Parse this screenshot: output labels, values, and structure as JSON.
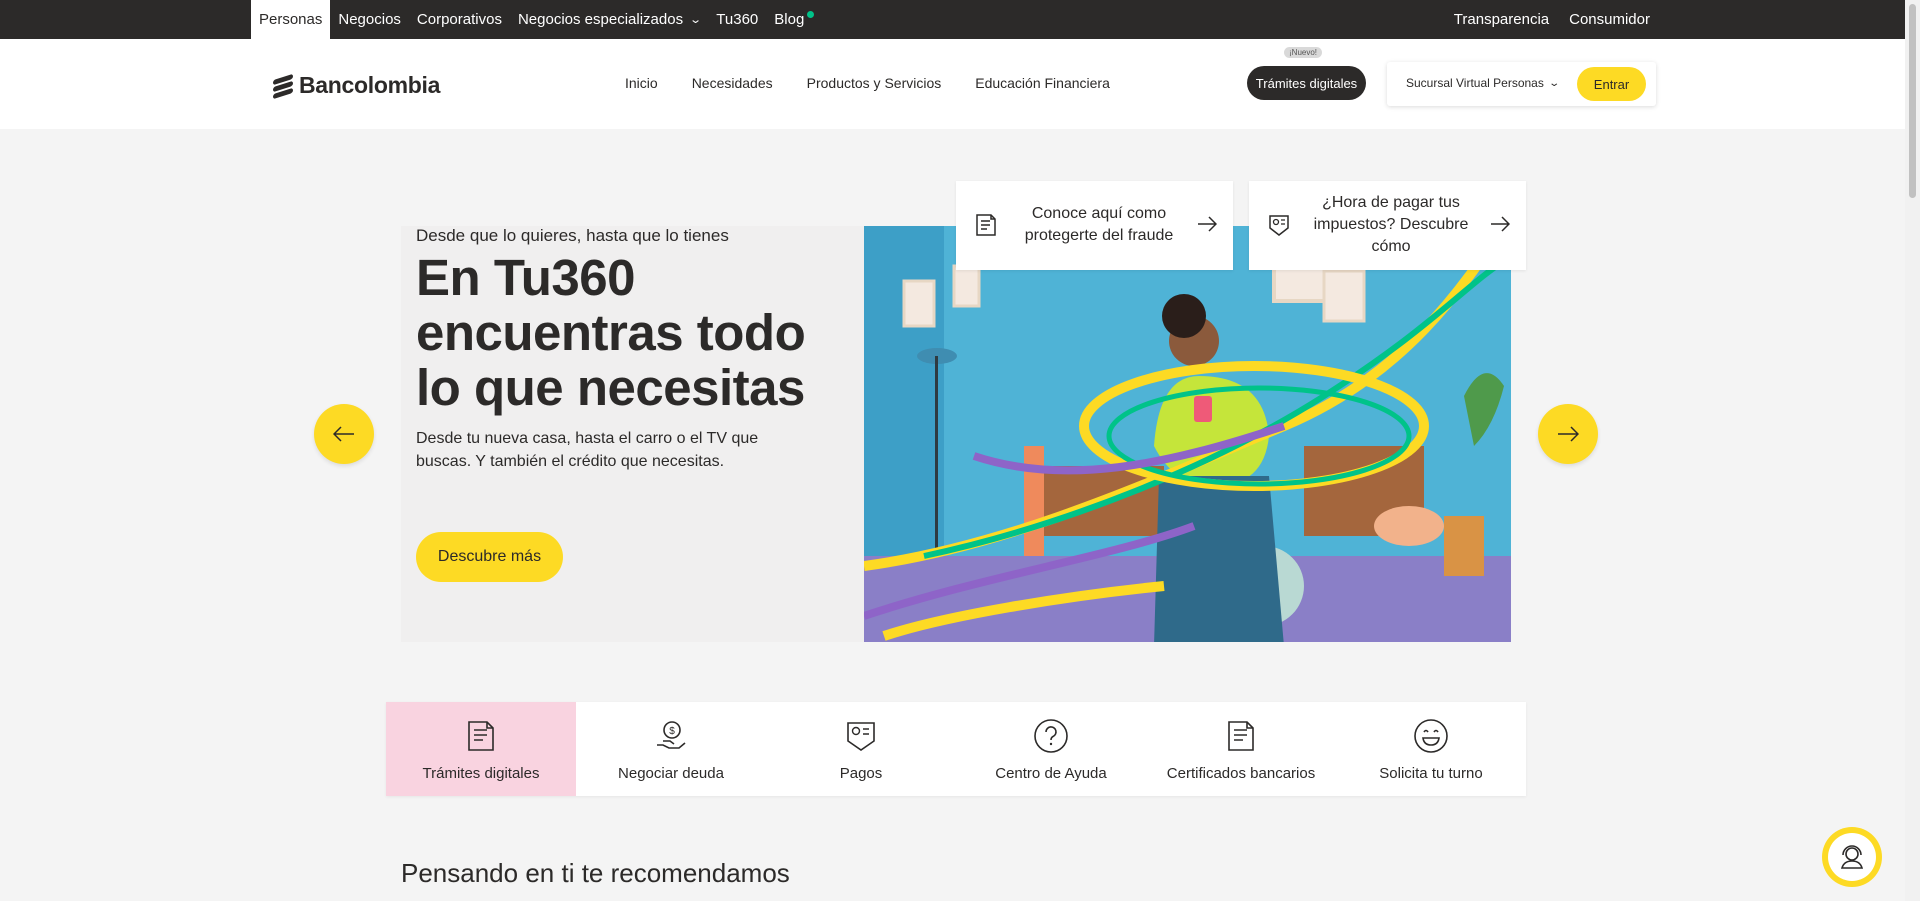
{
  "topbar": {
    "segments": [
      "Personas",
      "Negocios",
      "Corporativos",
      "Negocios especializados",
      "Tu360",
      "Blog"
    ],
    "right_links": [
      "Transparencia",
      "Consumidor"
    ]
  },
  "header": {
    "logo_text": "Bancolombia",
    "nav": [
      "Inicio",
      "Necesidades",
      "Productos y Servicios",
      "Educación Financiera"
    ],
    "tramites_label": "Trámites digitales",
    "nuevo_badge": "¡Nuevo!",
    "sucursal_label": "Sucursal Virtual Personas",
    "entrar_label": "Entrar"
  },
  "hero": {
    "eyebrow": "Desde que lo quieres, hasta que lo tienes",
    "title": "En Tu360 encuentras todo lo que necesitas",
    "description": "Desde tu nueva casa, hasta el carro o el TV que buscas. Y también el crédito que necesitas.",
    "cta": "Descubre más"
  },
  "quick_cards": [
    {
      "text": "Conoce aquí como protegerte del fraude",
      "icon": "document-icon"
    },
    {
      "text": "¿Hora de pagar tus impuestos? Descubre cómo",
      "icon": "bill-icon"
    }
  ],
  "shortcuts": [
    {
      "label": "Trámites digitales",
      "icon": "document-icon"
    },
    {
      "label": "Negociar deuda",
      "icon": "money-hand-icon"
    },
    {
      "label": "Pagos",
      "icon": "bill-icon"
    },
    {
      "label": "Centro de Ayuda",
      "icon": "question-icon"
    },
    {
      "label": "Certificados bancarios",
      "icon": "certificate-icon"
    },
    {
      "label": "Solicita tu turno",
      "icon": "smile-icon"
    }
  ],
  "section_title": "Pensando en ti te recomendamos",
  "colors": {
    "brand_yellow": "#fdda24",
    "dark": "#2c2a29",
    "active_pink": "#f9d3e0",
    "blog_dot": "#00c389"
  }
}
